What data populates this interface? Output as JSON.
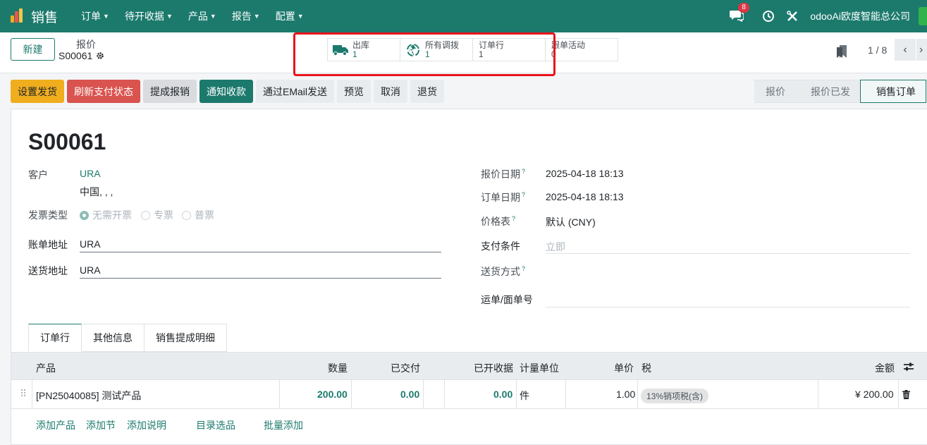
{
  "navbar": {
    "app_name": "销售",
    "menu": [
      "订单",
      "待开收据",
      "产品",
      "报告",
      "配置"
    ],
    "chat_badge": "8",
    "company": "odooAi欧度智能总公司"
  },
  "control": {
    "new_button": "新建",
    "breadcrumb_parent": "报价",
    "breadcrumb_current": "S00061",
    "smart_buttons": [
      {
        "label": "出库",
        "value": "1",
        "icon": "truck-icon"
      },
      {
        "label": "所有调拨",
        "value": "1",
        "icon": "recycle-icon"
      },
      {
        "label": "订单行",
        "value": "1",
        "icon": ""
      },
      {
        "label": "跟单活动",
        "value": "0",
        "icon": ""
      }
    ],
    "pager": "1 / 8"
  },
  "actions": [
    "设置发货",
    "刷新支付状态",
    "提成报销",
    "通知收款",
    "通过EMail发送",
    "预览",
    "取消",
    "退货"
  ],
  "status_steps": [
    "报价",
    "报价已发",
    "销售订单"
  ],
  "status_active": "销售订单",
  "form": {
    "title": "S00061",
    "customer_label": "客户",
    "customer_name": "URA",
    "customer_address": "中国, , ,",
    "invoice_type_label": "发票类型",
    "invoice_types": [
      "无需开票",
      "专票",
      "普票"
    ],
    "invoice_type_selected": "无需开票",
    "billing_address_label": "账单地址",
    "billing_address": "URA",
    "shipping_address_label": "送货地址",
    "shipping_address": "URA",
    "quote_date_label": "报价日期",
    "quote_date": "2025-04-18 18:13",
    "order_date_label": "订单日期",
    "order_date": "2025-04-18 18:13",
    "pricelist_label": "价格表",
    "pricelist": "默认 (CNY)",
    "payment_terms_label": "支付条件",
    "payment_terms_placeholder": "立即",
    "delivery_method_label": "送货方式",
    "tracking_label": "运单/面单号",
    "help_mark": "?"
  },
  "tabs": [
    "订单行",
    "其他信息",
    "销售提成明细"
  ],
  "table": {
    "headers": {
      "product": "产品",
      "qty": "数量",
      "delivered": "已交付",
      "invoiced": "已开收据",
      "uom": "计量单位",
      "price": "单价",
      "tax": "税",
      "amount": "金额"
    },
    "rows": [
      {
        "product": "[PN25040085] 测试产品",
        "qty": "200.00",
        "delivered": "0.00",
        "invoiced": "0.00",
        "uom": "件",
        "price": "1.00",
        "tax": "13%销项税(含)",
        "amount": "¥ 200.00"
      }
    ],
    "add_links": [
      "添加产品",
      "添加节",
      "添加说明",
      "目录选品",
      "批量添加"
    ]
  }
}
